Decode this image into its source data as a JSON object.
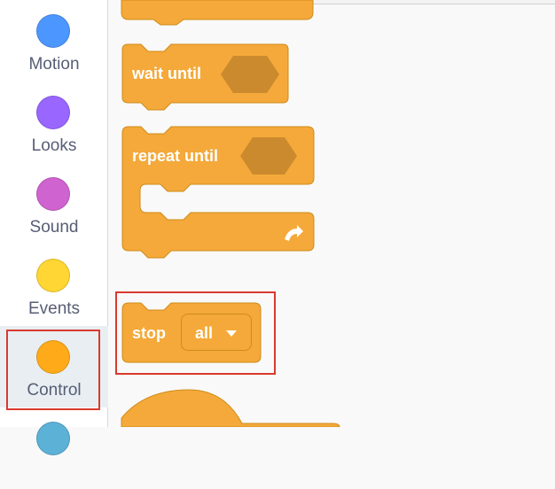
{
  "sidebar": {
    "categories": [
      {
        "label": "Motion",
        "color": "#4c97ff"
      },
      {
        "label": "Looks",
        "color": "#9966ff"
      },
      {
        "label": "Sound",
        "color": "#cf63cf"
      },
      {
        "label": "Events",
        "color": "#ffd633"
      },
      {
        "label": "Control",
        "color": "#ffab19",
        "selected": true
      },
      {
        "label": "",
        "color": "#5cb1d6"
      }
    ]
  },
  "blocks": {
    "wait_until": {
      "label": "wait until"
    },
    "repeat_until": {
      "label": "repeat until",
      "loop_icon": "loop-arrow-icon"
    },
    "stop": {
      "label": "stop",
      "option": "all",
      "dropdown_icon": "caret-down-icon"
    }
  },
  "colors": {
    "control_fill": "#f4a93a",
    "control_border": "#cf8b17",
    "input_slot": "#cc8a2e",
    "highlight": "#d93a2e"
  }
}
